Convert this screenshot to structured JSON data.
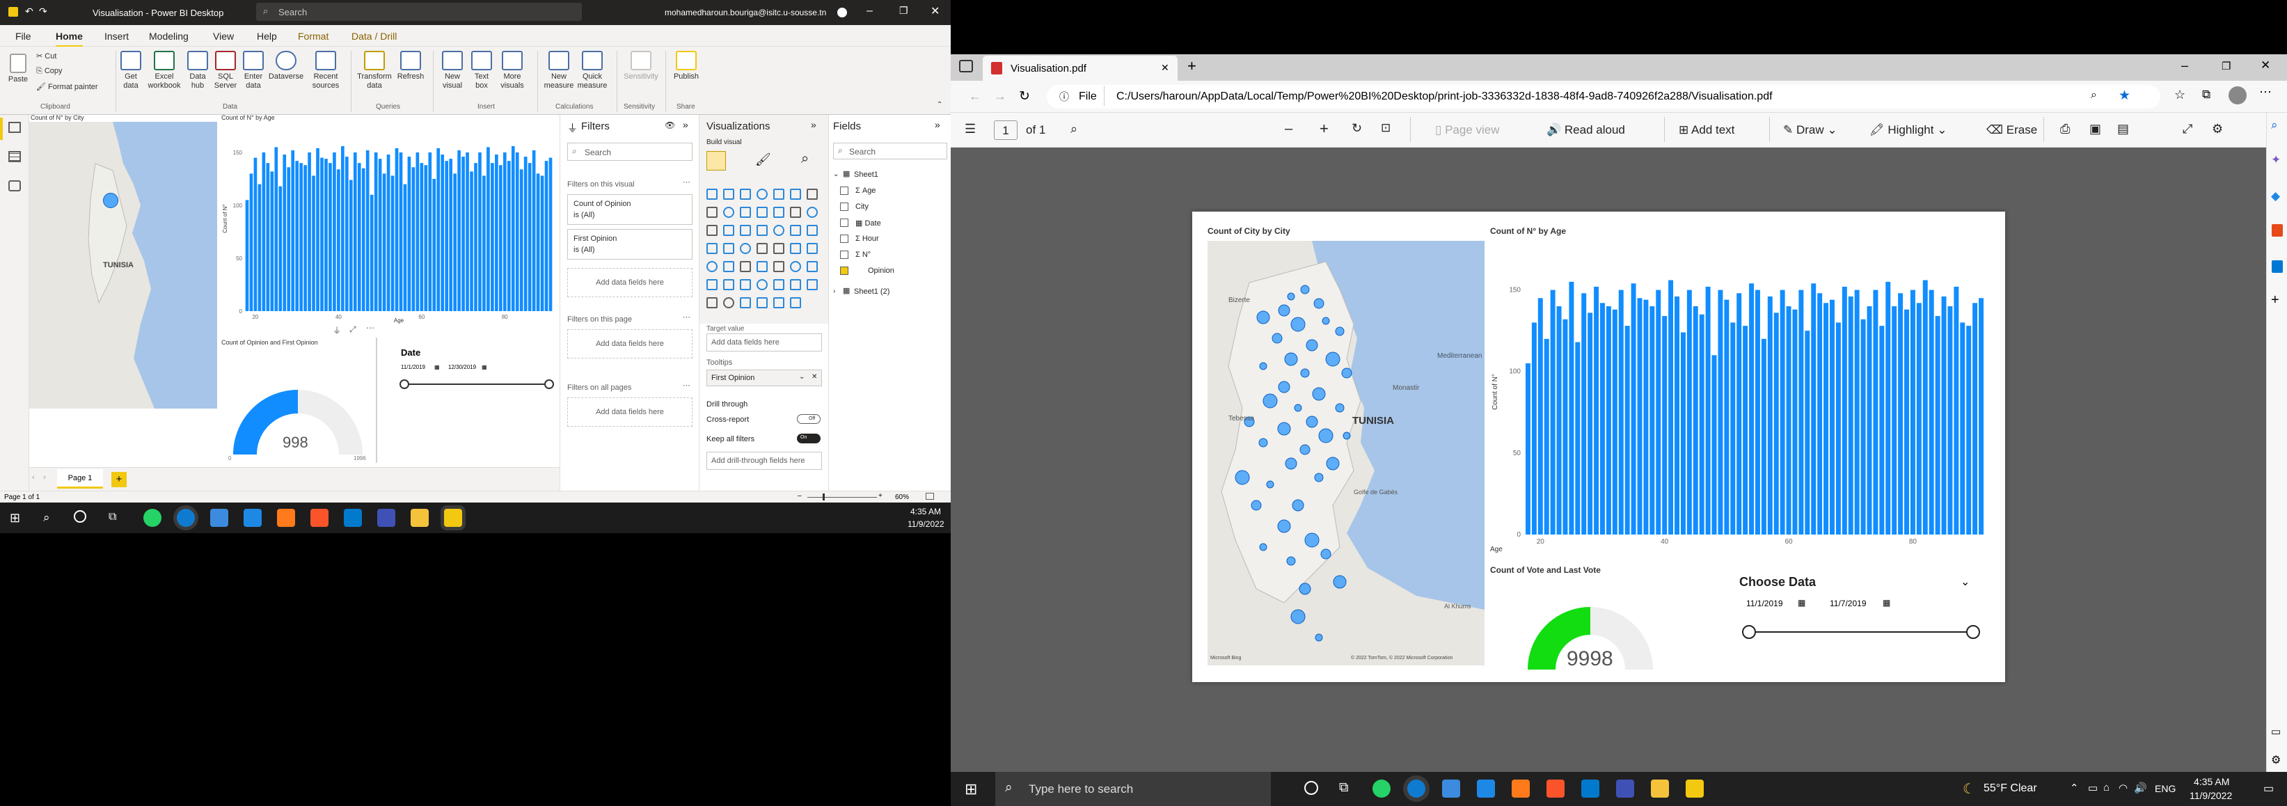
{
  "pbi": {
    "title": "Visualisation - Power BI Desktop",
    "search_placeholder": "Search",
    "user": "mohamedharoun.bouriga@isitc.u-sousse.tn",
    "menu": [
      "File",
      "Home",
      "Insert",
      "Modeling",
      "View",
      "Help",
      "Format",
      "Data / Drill"
    ],
    "ribbon": {
      "clipboard": [
        "Paste",
        "Cut",
        "Copy",
        "Format painter"
      ],
      "buttons": [
        "Get data",
        "Excel workbook",
        "Data hub",
        "SQL Server",
        "Enter data",
        "Dataverse",
        "Recent sources",
        "Transform data",
        "Refresh",
        "New visual",
        "Text box",
        "More visuals",
        "New measure",
        "Quick measure",
        "Sensitivity",
        "Publish"
      ],
      "groups": [
        "Clipboard",
        "Data",
        "Queries",
        "Insert",
        "Calculations",
        "Sensitivity",
        "Share"
      ]
    },
    "canvas": {
      "map_title": "Count of N° by City",
      "bar_title": "Count of N° by Age",
      "gauge_title": "Count of Opinion and First Opinion",
      "gauge_value": "998",
      "gauge_min": "0",
      "gauge_max": "1996",
      "slicer_title": "Date",
      "date_from": "11/1/2019",
      "date_to": "12/30/2019",
      "map_country": "TUNISIA",
      "age_label": "Age",
      "count_label": "Count of N°"
    },
    "page_tab": "Page 1",
    "status": "Page 1 of 1",
    "zoom": "60%",
    "filters": {
      "title": "Filters",
      "search": "Search",
      "on_visual": "Filters on this visual",
      "card1_name": "Count of Opinion",
      "card1_val": "is (All)",
      "card2_name": "First Opinion",
      "card2_val": "is (All)",
      "add": "Add data fields here",
      "on_page": "Filters on this page",
      "all_pages": "Filters on all pages"
    },
    "viz": {
      "title": "Visualizations",
      "build": "Build visual",
      "target": "Target value",
      "add": "Add data fields here",
      "tooltips": "Tooltips",
      "tooltip_field": "First Opinion",
      "drill": "Drill through",
      "cross": "Cross-report",
      "keep": "Keep all filters",
      "add_drill": "Add drill-through fields here",
      "off": "Off",
      "on": "On"
    },
    "fields": {
      "title": "Fields",
      "search": "Search",
      "table1": "Sheet1",
      "items": [
        "Age",
        "City",
        "Date",
        "Hour",
        "N°",
        "Opinion"
      ],
      "table2": "Sheet1 (2)"
    }
  },
  "taskbar_left": {
    "time": "4:35 AM",
    "date": "11/9/2022"
  },
  "edge": {
    "tab_title": "Visualisation.pdf",
    "file_label": "File",
    "url": "C:/Users/haroun/AppData/Local/Temp/Power%20BI%20Desktop/print-job-3336332d-1838-48f4-9ad8-740926f2a288/Visualisation.pdf",
    "page_num": "1",
    "page_of": "of 1",
    "tools": [
      "Page view",
      "Read aloud",
      "Add text",
      "Draw",
      "Highlight",
      "Erase"
    ]
  },
  "pdf": {
    "map_title": "Count of City by City",
    "bar_title": "Count of N° by Age",
    "country": "TUNISIA",
    "map_credit": "© 2022 TomTom, © 2022 Microsoft Corporation",
    "ms_bing": "Microsoft Bing",
    "gauge_title": "Count of Vote and Last Vote",
    "gauge_value": "9998",
    "slicer_title": "Choose Data",
    "date_from": "11/1/2019",
    "date_to": "11/7/2019",
    "ylabel": "Count of N°",
    "xlabel": "Age",
    "map_labels": [
      "Bizerte",
      "Tebessa",
      "Monastir",
      "Mediterranean",
      "Al Khums",
      "Golfe de Gabès"
    ]
  },
  "taskbar_right": {
    "search": "Type here to search",
    "weather": "55°F  Clear",
    "lang": "ENG",
    "time": "4:35 AM",
    "date": "11/9/2022"
  },
  "chart_data": {
    "type": "bar",
    "title": "Count of N° by Age",
    "xlabel": "Age",
    "ylabel": "Count of N°",
    "ylim": [
      0,
      175
    ],
    "x_ticks": [
      20,
      40,
      60,
      80
    ],
    "y_ticks": [
      0,
      50,
      100,
      150
    ],
    "x": [
      18,
      19,
      20,
      21,
      22,
      23,
      24,
      25,
      26,
      27,
      28,
      29,
      30,
      31,
      32,
      33,
      34,
      35,
      36,
      37,
      38,
      39,
      40,
      41,
      42,
      43,
      44,
      45,
      46,
      47,
      48,
      49,
      50,
      51,
      52,
      53,
      54,
      55,
      56,
      57,
      58,
      59,
      60,
      61,
      62,
      63,
      64,
      65,
      66,
      67,
      68,
      69,
      70,
      71,
      72,
      73,
      74,
      75,
      76,
      77,
      78,
      79,
      80,
      81,
      82,
      83,
      84,
      85,
      86,
      87,
      88,
      89,
      90,
      91
    ],
    "values": [
      105,
      130,
      145,
      120,
      150,
      140,
      132,
      155,
      118,
      148,
      136,
      152,
      142,
      140,
      138,
      150,
      128,
      154,
      145,
      144,
      140,
      150,
      134,
      156,
      146,
      124,
      150,
      140,
      135,
      152,
      110,
      150,
      144,
      130,
      148,
      128,
      154,
      150,
      120,
      146,
      136,
      150,
      140,
      138,
      150,
      125,
      154,
      148,
      142,
      144,
      130,
      152,
      146,
      150,
      132,
      140,
      150,
      128,
      155,
      140,
      148,
      138,
      150,
      142,
      156,
      150,
      134,
      146,
      140,
      152,
      130,
      128,
      142,
      145
    ]
  }
}
